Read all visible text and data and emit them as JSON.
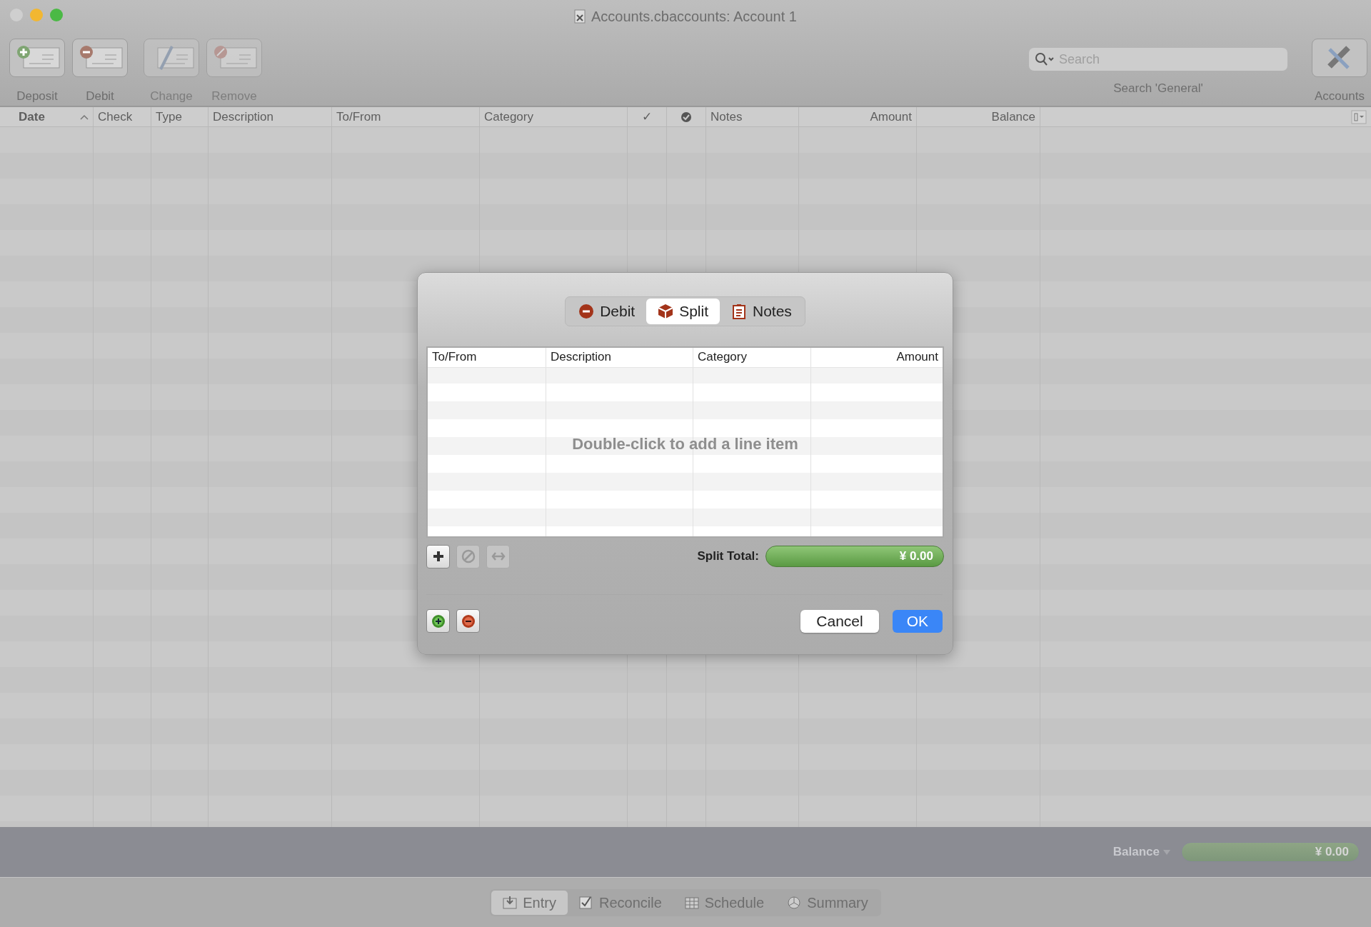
{
  "window": {
    "title": "Accounts.cbaccounts:  Account 1"
  },
  "toolbar": {
    "buttons": [
      {
        "label": "Deposit",
        "kind": "deposit",
        "disabled": false
      },
      {
        "label": "Debit",
        "kind": "debit",
        "disabled": false
      },
      {
        "label": "Change",
        "kind": "change",
        "disabled": true
      },
      {
        "label": "Remove",
        "kind": "remove",
        "disabled": true
      }
    ],
    "search": {
      "placeholder": "Search",
      "label": "Search 'General'"
    },
    "accounts_button": {
      "label": "Accounts"
    }
  },
  "register": {
    "columns": [
      {
        "label": "Date",
        "sorted": true
      },
      {
        "label": "Check",
        "sorted": false
      },
      {
        "label": "Type",
        "sorted": false
      },
      {
        "label": "Description",
        "sorted": false
      },
      {
        "label": "To/From",
        "sorted": false
      },
      {
        "label": "Category",
        "sorted": false
      },
      {
        "label": "✓",
        "sorted": false
      },
      {
        "kind": "icon",
        "sorted": false
      },
      {
        "label": "Notes",
        "sorted": false
      },
      {
        "label": "Amount",
        "sorted": false
      },
      {
        "label": "Balance",
        "sorted": false
      }
    ]
  },
  "balance_bar": {
    "label": "Balance",
    "value": "¥ 0.00"
  },
  "view_tabs": [
    {
      "label": "Entry",
      "kind": "entry",
      "selected": true
    },
    {
      "label": "Reconcile",
      "kind": "reconcile",
      "selected": false
    },
    {
      "label": "Schedule",
      "kind": "schedule",
      "selected": false
    },
    {
      "label": "Summary",
      "kind": "summary",
      "selected": false
    }
  ],
  "dialog": {
    "tabs": [
      {
        "label": "Debit",
        "kind": "debit",
        "selected": false
      },
      {
        "label": "Split",
        "kind": "split",
        "selected": true
      },
      {
        "label": "Notes",
        "kind": "notes",
        "selected": false
      }
    ],
    "split_table": {
      "columns": [
        {
          "label": "To/From"
        },
        {
          "label": "Description"
        },
        {
          "label": "Category"
        },
        {
          "label": "Amount"
        }
      ],
      "placeholder": "Double-click to add a line item"
    },
    "tools": [
      {
        "kind": "add",
        "disabled": false
      },
      {
        "kind": "void",
        "disabled": true
      },
      {
        "kind": "transfer",
        "disabled": true
      }
    ],
    "split_total": {
      "label": "Split Total:",
      "value": "¥ 0.00"
    },
    "entry_buttons": [
      {
        "kind": "add"
      },
      {
        "kind": "remove"
      }
    ],
    "actions": [
      {
        "kind": "cancel",
        "label": "Cancel"
      },
      {
        "kind": "ok",
        "label": "OK"
      }
    ]
  }
}
